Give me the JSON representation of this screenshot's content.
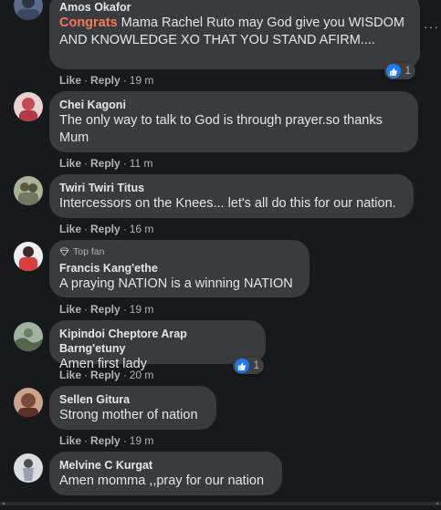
{
  "comments": [
    {
      "author": "Amos Okafor",
      "highlight": "Congrats",
      "text": " Mama Rachel Ruto may God give you WISDOM AND KNOWLEDGE XO THAT YOU STAND AFIRM....",
      "like": "Like",
      "reply": "Reply",
      "time": "19 m",
      "reactions": "1",
      "avatar_color": "#5a6a88"
    },
    {
      "author": "Chei Kagoni",
      "text": "The only way to talk to God is through prayer.so thanks Mum",
      "like": "Like",
      "reply": "Reply",
      "time": "11 m",
      "avatar_color": "#c44a55"
    },
    {
      "author": "Twiri Twiri Titus",
      "text": "Intercessors on the Knees... let's all do this for our nation.",
      "like": "Like",
      "reply": "Reply",
      "time": "16 m",
      "avatar_color": "#6e7a5c"
    },
    {
      "badge": "Top fan",
      "author": "Francis Kang'ethe",
      "text": "A praying NATION is a winning NATION",
      "like": "Like",
      "reply": "Reply",
      "time": "19 m",
      "avatar_color": "#d84040"
    },
    {
      "author": "Kipindoi Cheptore Arap Barng'etuny",
      "text": "Amen first lady",
      "like": "Like",
      "reply": "Reply",
      "time": "20 m",
      "reactions": "1",
      "avatar_color": "#6f7d66"
    },
    {
      "author": "Sellen Gitura",
      "text": "Strong mother of nation",
      "like": "Like",
      "reply": "Reply",
      "time": "19 m",
      "avatar_color": "#7a4a3c"
    },
    {
      "author": "Melvine C Kurgat",
      "text": "Amen momma ,,pray for our nation",
      "like": "Like",
      "reply": "Reply",
      "time": "19 m",
      "avatar_color": "#9aa0a8"
    }
  ],
  "colors": {
    "background": "#18191a",
    "bubble": "#3a3b3c",
    "text": "#e4e6eb",
    "secondary": "#b0b3b8",
    "like_blue": "#2078f4",
    "congrats": "#f3795c"
  }
}
